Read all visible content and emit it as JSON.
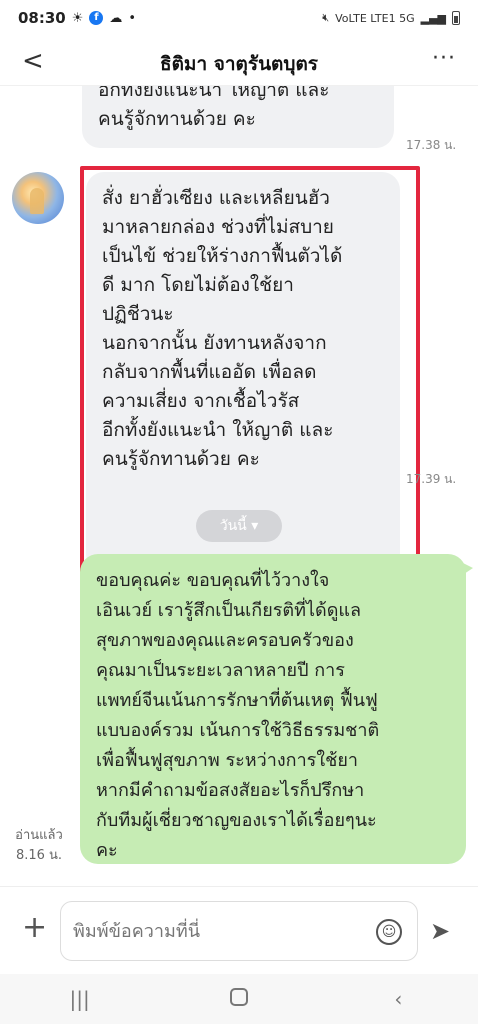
{
  "status_bar": {
    "time": "08:30",
    "icons_left": [
      "sun-icon",
      "facebook-icon",
      "cloud-icon",
      "dot"
    ],
    "network": "VoLTE LTE1 5G"
  },
  "header": {
    "title": "ธิติมา จาตุรันตบุตร",
    "back_label": "<",
    "more_label": "···"
  },
  "messages": [
    {
      "direction": "incoming",
      "text": "อีกทั้งยังแนะนำ ให้ญาติ และ\nคนรู้จักทานด้วย คะ",
      "time": "17.38 น."
    },
    {
      "direction": "incoming",
      "text": "สั่ง ยาฮั่วเซียง และเหลียนฮัว\nมาหลายกล่อง ช่วงที่ไม่สบาย\nเป็นไข้ ช่วยให้ร่างกาฟื้นตัวได้\nดี มาก โดยไม่ต้องใช้ยา\nปฏิชีวนะ\nนอกจากนั้น ยังทานหลังจาก\nกลับจากพื้นที่แออัด เพื่อลด\nความเสี่ยง จากเชื้อไวรัส\nอีกทั้งยังแนะนำ ให้ญาติ และ\nคนรู้จักทานด้วย คะ",
      "time": "17.39 น."
    },
    {
      "direction": "outgoing",
      "text": "ขอบคุณค่ะ ขอบคุณที่ไว้วางใจ\nเอินเวย์ เรารู้สึกเป็นเกียรติที่ได้ดูแล\nสุขภาพของคุณและครอบครัวของ\nคุณมาเป็นระยะเวลาหลายปี การ\nแพทย์จีนเน้นการรักษาที่ต้นเหตุ ฟื้นฟู\nแบบองค์รวม เน้นการใช้วิธีธรรมชาติ\nเพื่อฟื้นฟูสุขภาพ ระหว่างการใช้ยา\nหากมีคำถามข้อสงสัยอะไรก็ปรึกษา\nกับทีมผู้เชี่ยวชาญของเราได้เรื่อยๆนะ\nคะ",
      "read": "อ่านแล้ว",
      "time": "8.16 น."
    }
  ],
  "date_divider": "วันนี้ ▾",
  "input": {
    "placeholder": "พิมพ์ข้อความที่นี่"
  },
  "colors": {
    "incoming_bubble": "#f0f1f3",
    "outgoing_bubble": "#c6ecb4",
    "highlight_border": "#e3263e"
  }
}
